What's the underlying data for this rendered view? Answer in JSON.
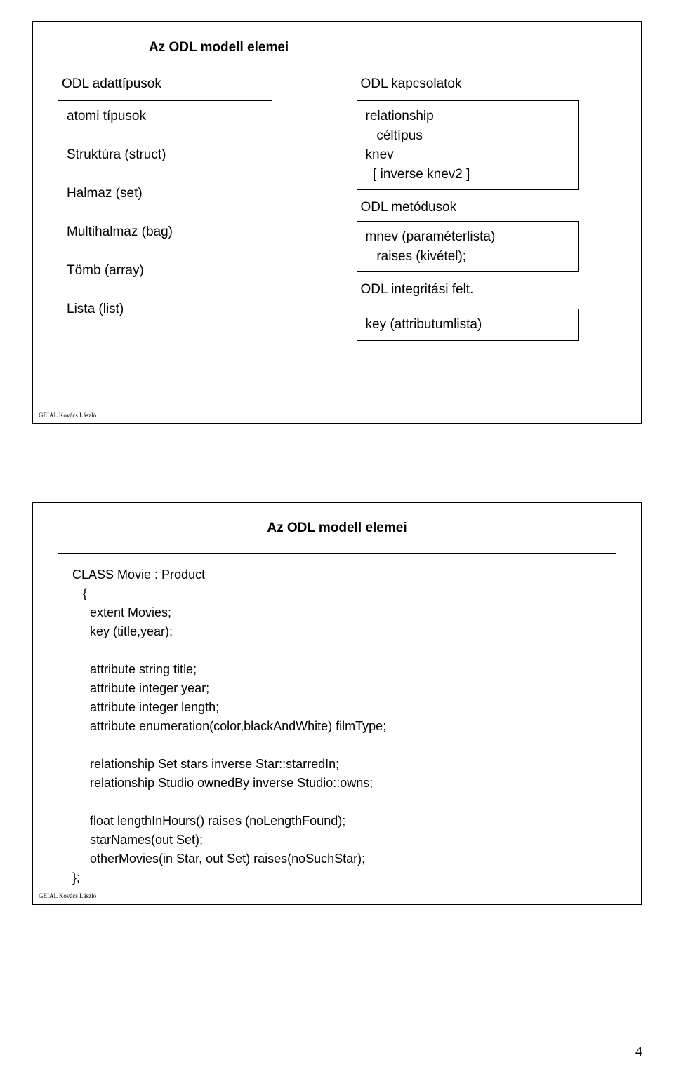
{
  "slide1": {
    "title": "Az ODL modell elemei",
    "left": {
      "heading": "ODL adattípusok",
      "box": "atomi típusok\n\nStruktúra (struct)\n\nHalmaz (set)\n\nMultihalmaz (bag)\n\nTömb (array)\n\nLista (list)"
    },
    "right": {
      "heading1": "ODL kapcsolatok",
      "box1": "relationship\n   céltípus\nknev\n  [ inverse knev2 ]",
      "heading2": "ODL metódusok",
      "box2": "mnev (paraméterlista)\n   raises (kivétel);",
      "heading3": "ODL integritási felt.",
      "box3": "key (attributumlista)"
    },
    "footer": "GEIAL Kovács László"
  },
  "slide2": {
    "title": "Az ODL modell elemei",
    "code": "CLASS Movie : Product\n   {\n     extent Movies;\n     key (title,year);\n\n     attribute string title;\n     attribute integer year;\n     attribute integer length;\n     attribute enumeration(color,blackAndWhite) filmType;\n\n     relationship Set stars inverse Star::starredIn;\n     relationship Studio ownedBy inverse Studio::owns;\n\n     float lengthInHours() raises (noLengthFound);\n     starNames(out Set);\n     otherMovies(in Star, out Set) raises(noSuchStar);\n};",
    "footer": "GEIAL Kovács László"
  },
  "page_number": "4"
}
